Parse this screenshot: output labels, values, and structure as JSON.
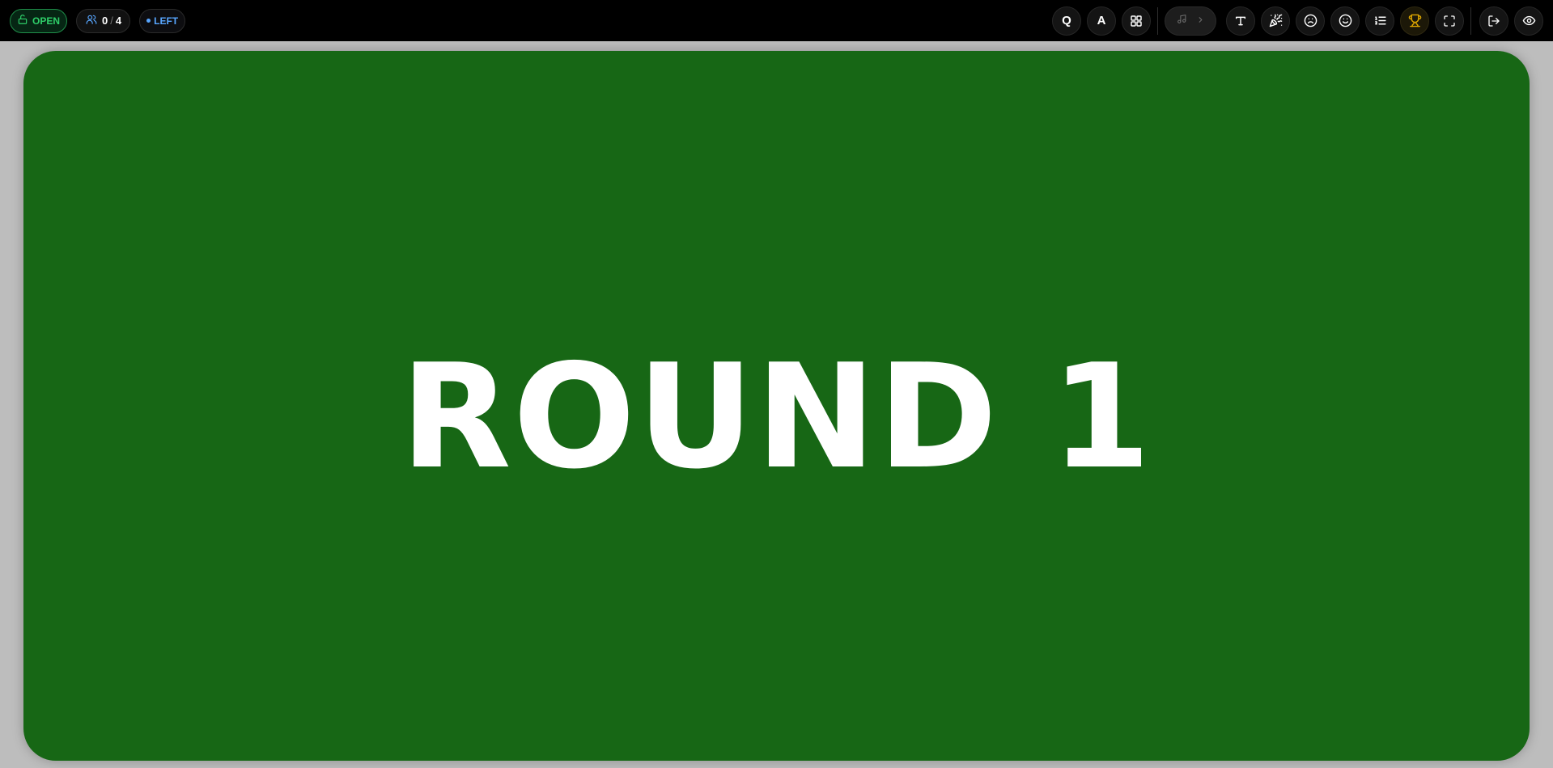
{
  "topbar": {
    "status": {
      "label": "OPEN",
      "icon": "lock-open-icon",
      "color": "#2fd06a"
    },
    "players": {
      "current": "0",
      "separator": "/",
      "max": "4",
      "icon": "users-icon"
    },
    "side": {
      "label": "LEFT",
      "color": "#58a6ff"
    },
    "actions": {
      "question_label": "Q",
      "answer_label": "A",
      "grid_icon": "grid-icon",
      "music_icon": "music-note-icon",
      "music_next_icon": "chevron-right-icon",
      "text_icon": "text-icon",
      "confetti_icon": "party-popper-icon",
      "sad_icon": "frown-icon",
      "smile_icon": "smile-icon",
      "list_icon": "list-ordered-icon",
      "trophy_icon": "trophy-icon",
      "fullscreen_icon": "fullscreen-icon",
      "exit_icon": "log-out-icon",
      "view_icon": "eye-icon"
    },
    "trophy_color": "#e0a800"
  },
  "slide": {
    "title": "ROUND 1",
    "background_color": "#176715",
    "text_color": "#ffffff"
  }
}
